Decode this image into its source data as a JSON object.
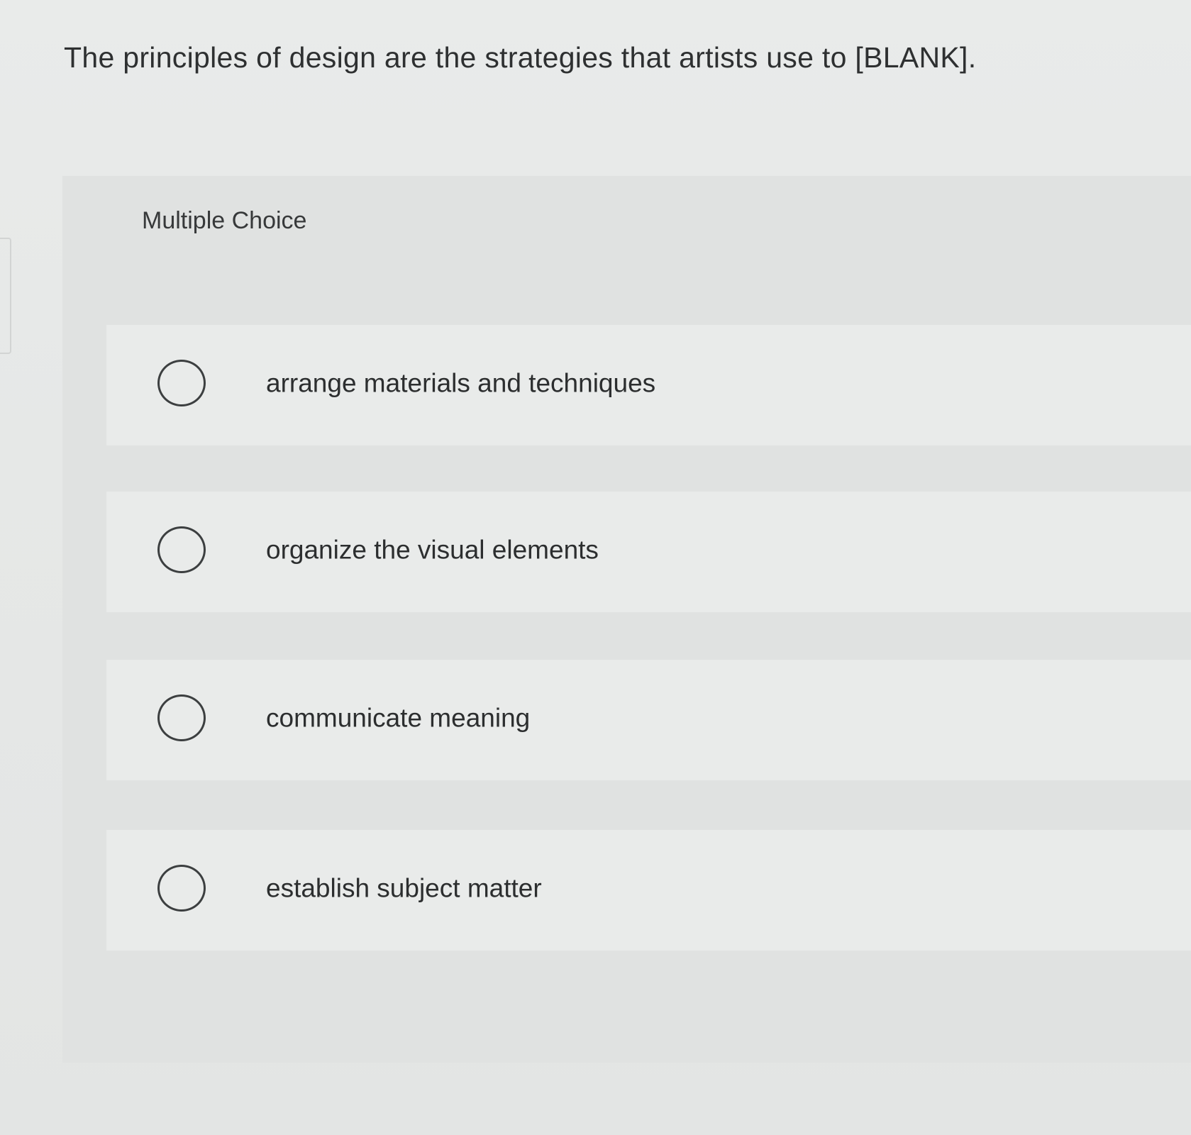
{
  "question": {
    "text": "The principles of design are the strategies that artists use to [BLANK]."
  },
  "answer_panel": {
    "type_label": "Multiple Choice",
    "options": [
      {
        "label": "arrange materials and techniques",
        "selected": false
      },
      {
        "label": "organize the visual elements",
        "selected": false
      },
      {
        "label": "communicate meaning",
        "selected": false
      },
      {
        "label": "establish subject matter",
        "selected": false
      }
    ]
  }
}
